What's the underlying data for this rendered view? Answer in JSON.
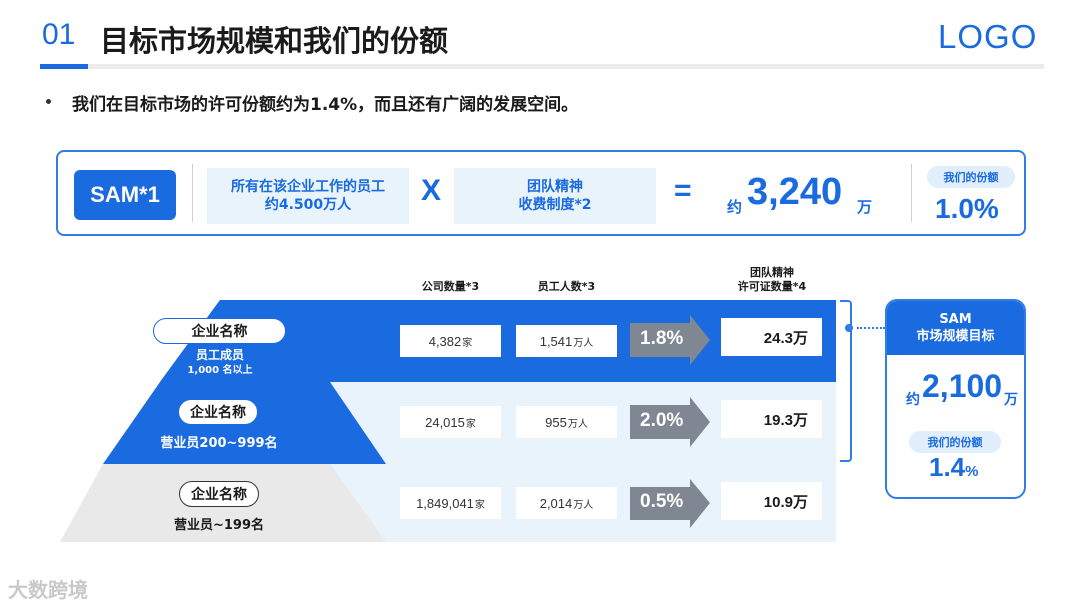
{
  "header": {
    "number": "01",
    "title": "目标市场规模和我们的份额",
    "logo": "LOGO"
  },
  "bullet": "我们在目标市场的许可份额约为1.4%，而且还有广阔的发展空间。",
  "sam": {
    "tag": "SAM*1",
    "factor1_line1": "所有在该企业工作的员工",
    "factor1_line2": "约4.500万人",
    "op_multiply": "X",
    "factor2_line1": "团队精神",
    "factor2_line2": "收费制度*2",
    "op_equals": "=",
    "total_prefix": "约",
    "total_value": "3,240",
    "total_unit": "万",
    "share_label": "我们的份额",
    "share_value": "1.0%"
  },
  "columns": {
    "companies": "公司数量*3",
    "employees": "员工人数*3",
    "licenses_line1": "团队精神",
    "licenses_line2": "许可证数量*4"
  },
  "units": {
    "company": "家",
    "people": "万人"
  },
  "segments": [
    {
      "name": "企业名称",
      "sub1": "员工成员",
      "sub2": "1,000 名以上",
      "companies": "4,382",
      "employees": "1,541",
      "rate": "1.8%",
      "licenses": "24.3万"
    },
    {
      "name": "企业名称",
      "sub1": "营业员200~999名",
      "companies": "24,015",
      "employees": "955",
      "rate": "2.0%",
      "licenses": "19.3万"
    },
    {
      "name": "企业名称",
      "sub1": "营业员~199名",
      "companies": "1,849,041",
      "employees": "2,014",
      "rate": "0.5%",
      "licenses": "10.9万"
    }
  ],
  "target": {
    "line1": "SAM",
    "line2": "市场规模目标",
    "prefix": "约",
    "value": "2,100",
    "unit": "万",
    "share_label": "我们的份额",
    "share_value": "1.4",
    "share_unit": "%"
  },
  "watermark": "大数跨境",
  "colors": {
    "primary": "#1a6ae0",
    "light": "#e8f3fb",
    "gray_arrow": "#7f8793",
    "gray_band": "#ececec"
  }
}
